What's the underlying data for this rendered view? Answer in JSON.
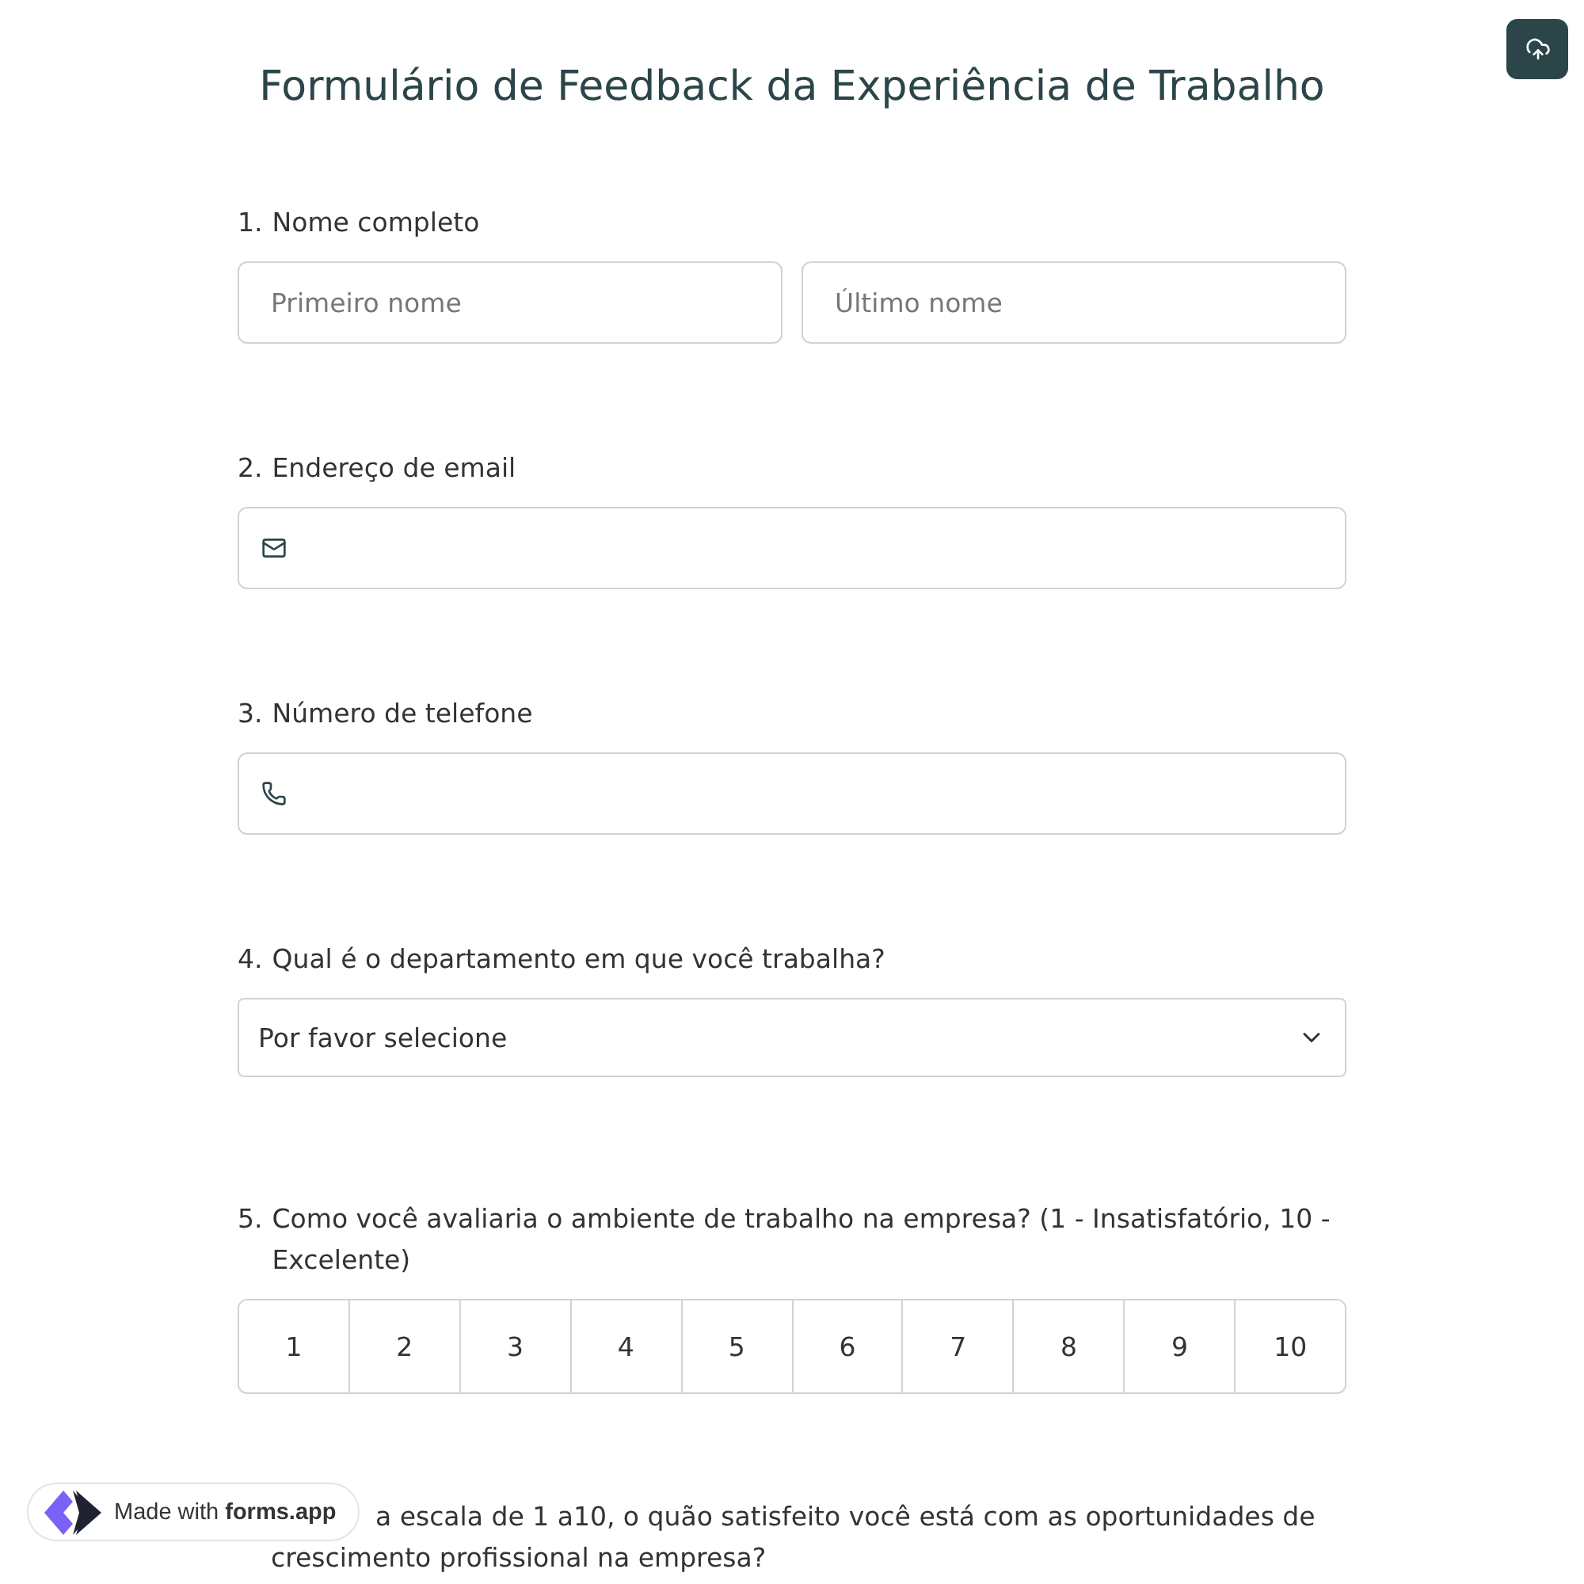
{
  "title": "Formulário de Feedback da Experiência de Trabalho",
  "questions": [
    {
      "kind": "name",
      "number": "1.",
      "label": "Nome completo",
      "placeholders": [
        "Primeiro nome",
        "Último nome"
      ]
    },
    {
      "kind": "email",
      "number": "2.",
      "label": "Endereço de email"
    },
    {
      "kind": "phone",
      "number": "3.",
      "label": "Número de telefone"
    },
    {
      "kind": "select",
      "number": "4.",
      "label": "Qual é o departamento em que você trabalha?",
      "value": "Por favor selecione"
    },
    {
      "kind": "rating",
      "number": "5.",
      "label": "Como você avaliaria o ambiente de trabalho na empresa? (1 - Insatisfatório, 10 - Excelente)",
      "options": [
        {
          "label": "1",
          "selected": false
        },
        {
          "label": "2",
          "selected": false
        },
        {
          "label": "3",
          "selected": false
        },
        {
          "label": "4",
          "selected": false
        },
        {
          "label": "5",
          "selected": false
        },
        {
          "label": "6",
          "selected": false
        },
        {
          "label": "7",
          "selected": false
        },
        {
          "label": "8",
          "selected": false
        },
        {
          "label": "9",
          "selected": false
        },
        {
          "label": "10",
          "selected": false
        }
      ]
    },
    {
      "kind": "covered",
      "lines": [
        "a escala de 1 a10, o quão satisfeito você está com as oportunidades de",
        "crescimento profissional na empresa?"
      ]
    }
  ],
  "badge": {
    "prefix": "Made with",
    "brand": "forms.app"
  }
}
